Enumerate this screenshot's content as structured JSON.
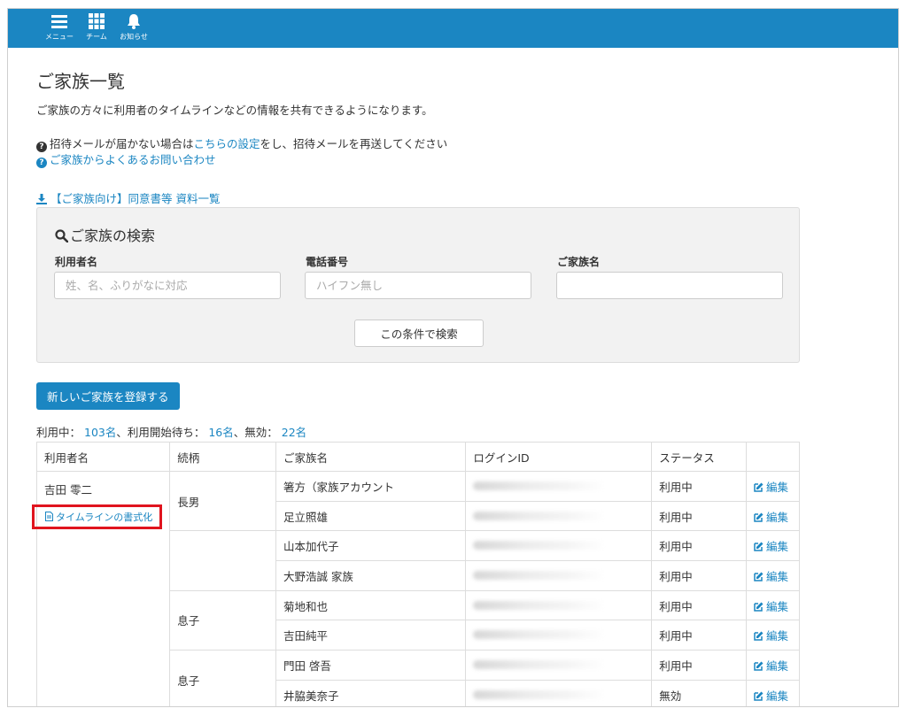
{
  "nav": {
    "menu": "メニュー",
    "team": "チーム",
    "notifications": "お知らせ"
  },
  "page": {
    "title": "ご家族一覧",
    "description": "ご家族の方々に利用者のタイムラインなどの情報を共有できるようになります。",
    "invite_note_before": "招待メールが届かない場合は",
    "invite_note_link": "こちらの設定",
    "invite_note_after": "をし、招待メールを再送してください",
    "faq_link": "ご家族からよくあるお問い合わせ",
    "download_link": "【ご家族向け】同意書等 資料一覧"
  },
  "search": {
    "title": "ご家族の検索",
    "user_label": "利用者名",
    "user_placeholder": "姓、名、ふりがなに対応",
    "phone_label": "電話番号",
    "phone_placeholder": "ハイフン無し",
    "family_label": "ご家族名",
    "family_placeholder": "",
    "submit": "この条件で検索"
  },
  "register_button": "新しいご家族を登録する",
  "stats": {
    "active_label": "利用中：",
    "active_count": "103名",
    "sep1": "、利用開始待ち：",
    "waiting_count": "16名",
    "sep2": "、無効：",
    "inactive_count": "22名"
  },
  "table": {
    "headers": [
      "利用者名",
      "続柄",
      "ご家族名",
      "ログインID",
      "ステータス",
      ""
    ],
    "user_name": "吉田 零二",
    "timeline_link": "タイムラインの書式化",
    "edit_label": "編集",
    "rows": [
      {
        "relation": "長男",
        "family": "箸方（家族アカウント",
        "status": "利用中"
      },
      {
        "relation": "",
        "family": "足立照雄",
        "status": "利用中"
      },
      {
        "relation": "",
        "family": "山本加代子",
        "status": "利用中"
      },
      {
        "relation": "",
        "family": "大野浩誠 家族",
        "status": "利用中"
      },
      {
        "relation": "息子",
        "family": "菊地和也",
        "status": "利用中"
      },
      {
        "relation": "",
        "family": "吉田純平",
        "status": "利用中"
      },
      {
        "relation": "息子",
        "family": "門田 啓吾",
        "status": "利用中"
      },
      {
        "relation": "",
        "family": "井脇美奈子",
        "status": "無効"
      }
    ]
  },
  "colors": {
    "brand": "#1b86c2",
    "highlight": "#e0141e"
  }
}
